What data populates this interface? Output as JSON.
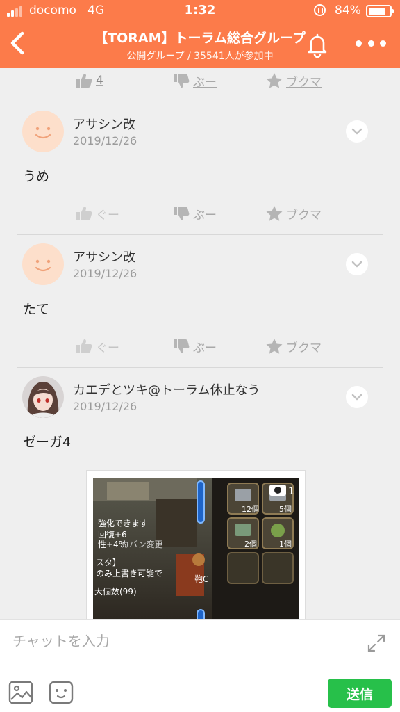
{
  "status_bar": {
    "carrier": "docomo",
    "network": "4G",
    "time": "1:32",
    "battery_text": "84%",
    "battery_level": 0.84
  },
  "header": {
    "title": "【TORAM】トーラム総合グループ",
    "subtitle": "公開グループ / 35541人が参加中"
  },
  "top_reactions": {
    "like_label": "4",
    "boo_label": "ぶー",
    "bookmark_label": "ブクマ"
  },
  "posts": [
    {
      "author": "アサシン改",
      "date": "2019/12/26",
      "text": "うめ",
      "avatar": "smile-face",
      "reactions": {
        "like_label": "ぐー",
        "boo_label": "ぶー",
        "bookmark_label": "ブクマ"
      }
    },
    {
      "author": "アサシン改",
      "date": "2019/12/26",
      "text": "たて",
      "avatar": "smile-face",
      "reactions": {
        "like_label": "ぐー",
        "boo_label": "ぶー",
        "bookmark_label": "ブクマ"
      }
    },
    {
      "author": "カエデとツキ@トーラム休止なう",
      "date": "2019/12/26",
      "text": "ゼーガ4",
      "avatar": "anime-character",
      "attachment": {
        "type": "game-screenshot",
        "photo_count": "1",
        "text_lines": [
          "強化できます",
          "回復+6",
          "性+4%",
          "カバン変更",
          "スタ】",
          "のみ上書き可能で",
          "大個数(99)",
          "鞄C"
        ],
        "slot_counts": [
          "12個",
          "5個",
          "2個",
          "1個"
        ]
      }
    }
  ],
  "input_bar": {
    "placeholder": "チャットを入力",
    "value": "",
    "send_label": "送信"
  },
  "colors": {
    "accent": "#fc7b4a",
    "send": "#27c04a",
    "background": "#efefef",
    "muted": "#a8a8a8"
  },
  "icons": [
    "back-icon",
    "bell-icon",
    "more-icon",
    "thumb-up-icon",
    "thumb-down-icon",
    "star-icon",
    "chevron-down-icon",
    "expand-icon",
    "image-icon",
    "sticker-icon"
  ]
}
